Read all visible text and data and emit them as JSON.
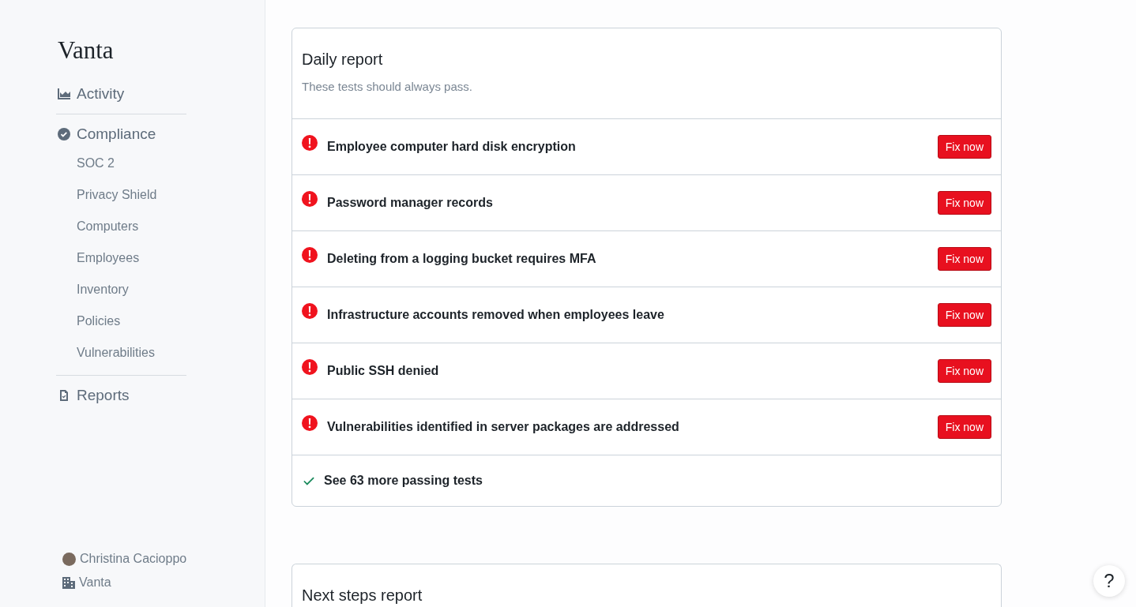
{
  "sidebar": {
    "logo": "Vanta",
    "nav": [
      {
        "label": "Activity"
      },
      {
        "label": "Compliance",
        "children": [
          {
            "label": "SOC 2"
          },
          {
            "label": "Privacy Shield"
          },
          {
            "label": "Computers"
          },
          {
            "label": "Employees"
          },
          {
            "label": "Inventory"
          },
          {
            "label": "Policies"
          },
          {
            "label": "Vulnerabilities"
          }
        ]
      },
      {
        "label": "Reports"
      }
    ],
    "user": "Christina Cacioppo",
    "organization": "Vanta"
  },
  "daily_report": {
    "title": "Daily report",
    "subtitle": "These tests should always pass.",
    "tests": [
      {
        "name": "Employee computer hard disk encryption",
        "failing": true,
        "action": "Fix now"
      },
      {
        "name": "Password manager records",
        "failing": true,
        "action": "Fix now"
      },
      {
        "name": "Deleting from a logging bucket requires MFA",
        "failing": true,
        "action": "Fix now"
      },
      {
        "name": "Infrastructure accounts removed when employees leave",
        "failing": true,
        "action": "Fix now"
      },
      {
        "name": "Public SSH denied",
        "failing": true,
        "action": "Fix now"
      },
      {
        "name": "Vulnerabilities identified in server packages are addressed",
        "failing": true,
        "action": "Fix now"
      }
    ],
    "footer": "See 63 more passing tests"
  },
  "next_report": {
    "title": "Next steps report"
  },
  "help_button": "?"
}
